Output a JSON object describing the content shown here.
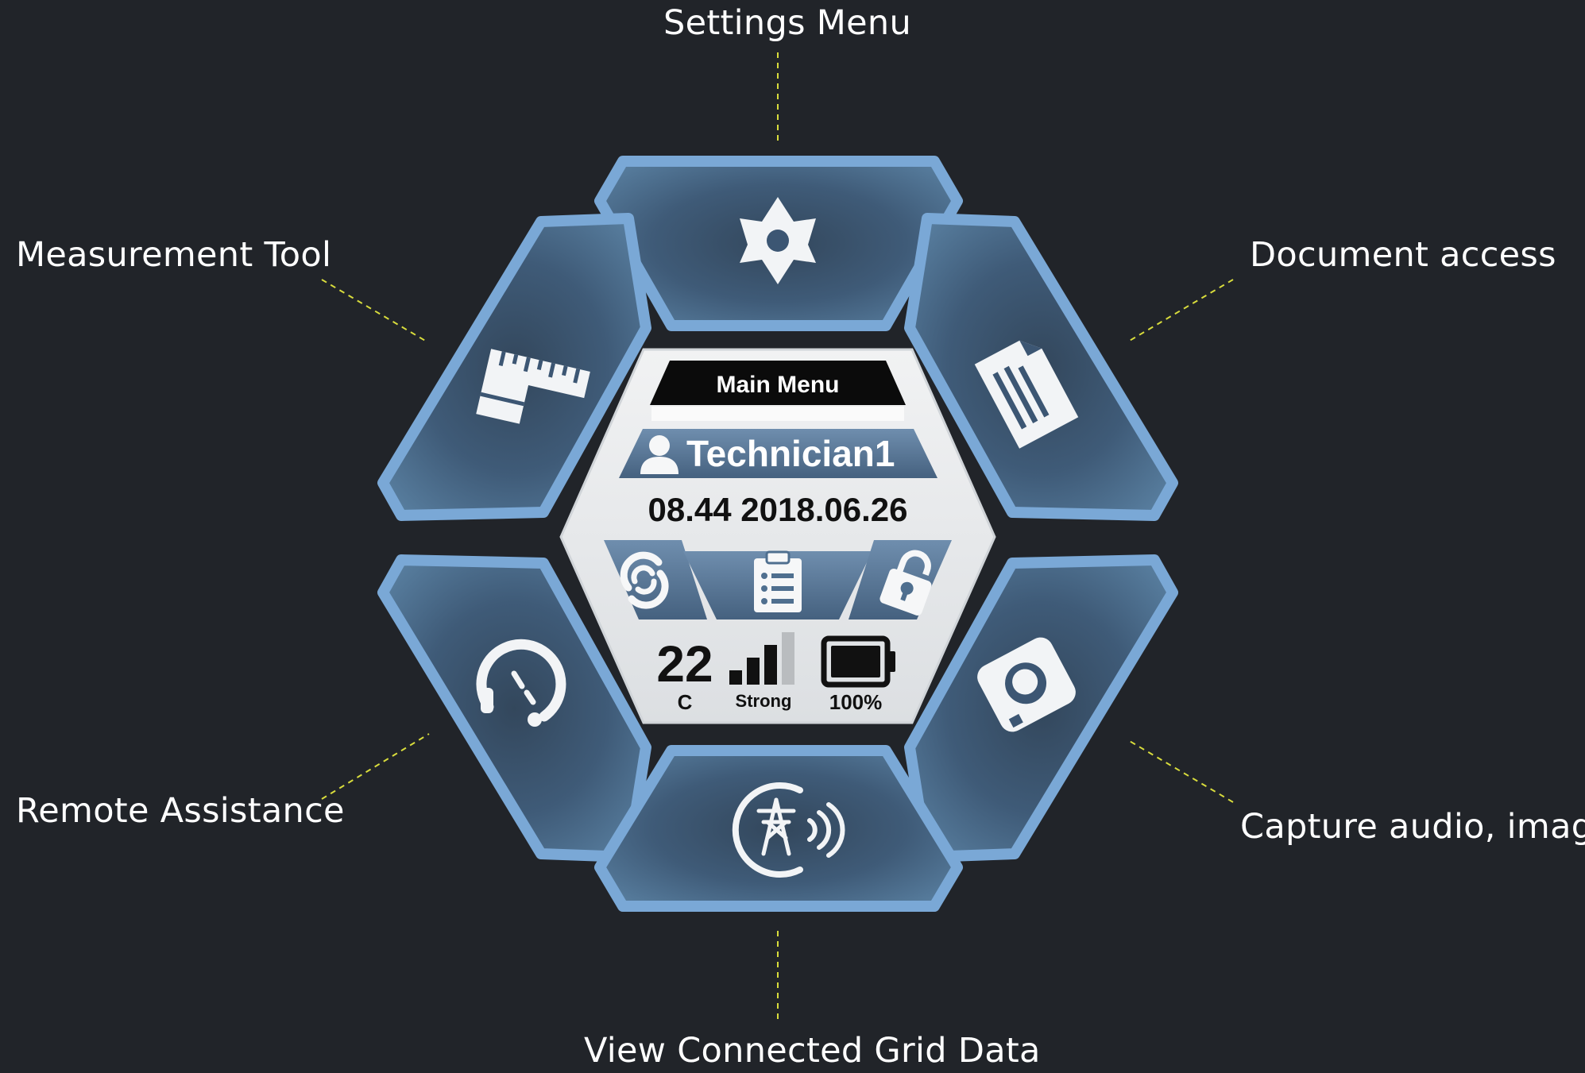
{
  "callouts": {
    "settings": "Settings Menu",
    "measurement": "Measurement Tool",
    "document": "Document access",
    "remote": "Remote Assistance",
    "capture": "Capture audio, image",
    "grid": "View Connected Grid Data"
  },
  "center": {
    "title": "Main Menu",
    "user": "Technician1",
    "datetime": "08.44 2018.06.26",
    "temperature": "22",
    "temperature_unit": "C",
    "signal_label": "Strong",
    "signal_bars": 3,
    "signal_bars_total": 4,
    "battery_label": "100%",
    "battery_level": 1.0
  },
  "icons": {
    "settings": "gear-icon",
    "measurement": "ruler-icon",
    "document": "document-icon",
    "remote": "headset-icon",
    "capture": "camera-icon",
    "grid": "power-tower-icon",
    "user": "user-icon",
    "sync": "sync-icon",
    "checklist": "clipboard-icon",
    "lock": "lock-icon"
  },
  "colors": {
    "background": "#212429",
    "tile_fill": "#4f6f8f",
    "tile_border": "#6f9ccc",
    "center_fill": "#e6e8ea",
    "leader_line": "#d8dc3c"
  }
}
